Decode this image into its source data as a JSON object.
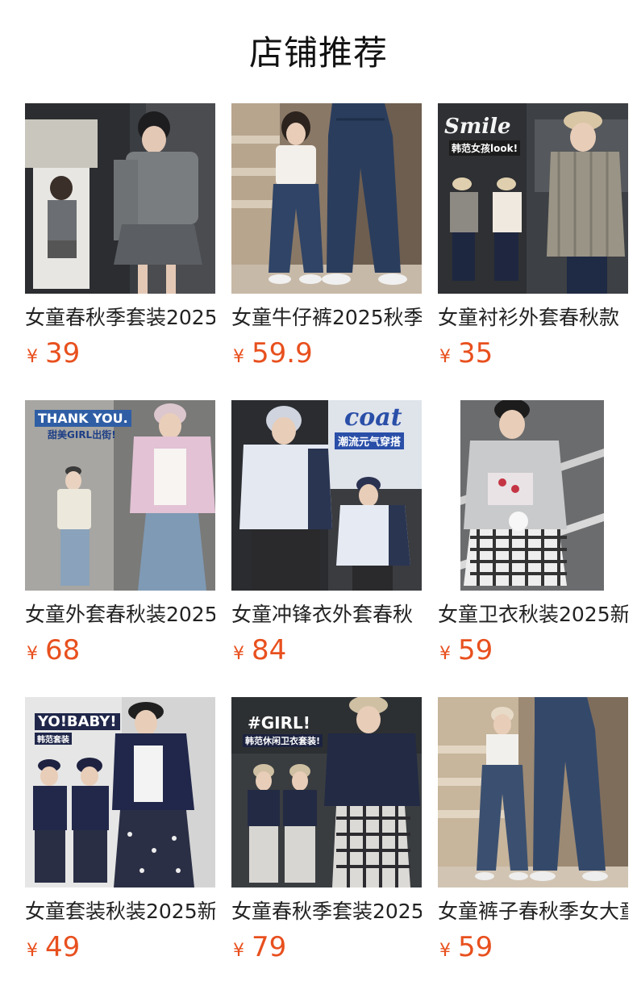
{
  "page": {
    "title": "店铺推荐"
  },
  "products": [
    {
      "title": "女童春秋季套装2025",
      "currency": "¥",
      "price": "39",
      "image_icon": "product-photo",
      "overlay": []
    },
    {
      "title": "女童牛仔裤2025秋季",
      "currency": "¥",
      "price": "59.9",
      "image_icon": "product-photo",
      "overlay": []
    },
    {
      "title": "女童衬衫外套春秋款",
      "currency": "¥",
      "price": "35",
      "image_icon": "product-photo",
      "overlay": [
        "Smile",
        "韩范女孩look!"
      ]
    },
    {
      "title": "女童外套春秋装2025",
      "currency": "¥",
      "price": "68",
      "image_icon": "product-photo",
      "overlay": [
        "THANK YOU.",
        "甜美GIRL出街!"
      ]
    },
    {
      "title": "女童冲锋衣外套春秋",
      "currency": "¥",
      "price": "84",
      "image_icon": "product-photo",
      "overlay": [
        "coat",
        "潮流元气穿搭"
      ]
    },
    {
      "title": "女童卫衣秋装2025新",
      "currency": "¥",
      "price": "59",
      "image_icon": "product-photo",
      "overlay": []
    },
    {
      "title": "女童套装秋装2025新",
      "currency": "¥",
      "price": "49",
      "image_icon": "product-photo",
      "overlay": [
        "YO!BABY!",
        "韩范套装"
      ]
    },
    {
      "title": "女童春秋季套装2025",
      "currency": "¥",
      "price": "79",
      "image_icon": "product-photo",
      "overlay": [
        "#GIRL!",
        "韩范休闲卫衣套装!"
      ]
    },
    {
      "title": "女童裤子春秋季女大童",
      "currency": "¥",
      "price": "59",
      "image_icon": "product-photo",
      "overlay": []
    }
  ],
  "colors": {
    "price": "#e8501e",
    "title": "#222222",
    "heading": "#111111"
  }
}
